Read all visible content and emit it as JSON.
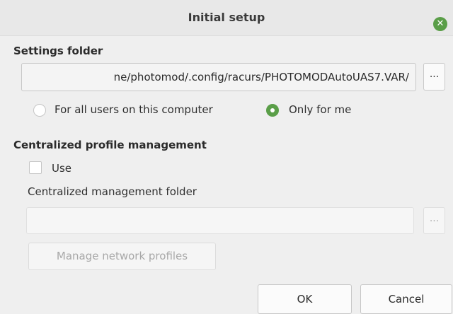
{
  "window": {
    "title": "Initial setup",
    "close_icon": "close-icon",
    "accent_color": "#5a9e48"
  },
  "settings_folder": {
    "heading": "Settings folder",
    "path": "ne/photomod/.config/racurs/PHOTOMODAutoUAS7.VAR/",
    "browse_label": "...",
    "scope_options": [
      {
        "label": "For all users on this computer",
        "selected": false
      },
      {
        "label": "Only for me",
        "selected": true
      }
    ]
  },
  "centralized": {
    "heading": "Centralized profile management",
    "use_label": "Use",
    "use_checked": false,
    "folder_label": "Centralized management folder",
    "folder_value": "",
    "browse_label": "...",
    "manage_button": "Manage network profiles"
  },
  "actions": {
    "ok": "OK",
    "cancel": "Cancel"
  }
}
